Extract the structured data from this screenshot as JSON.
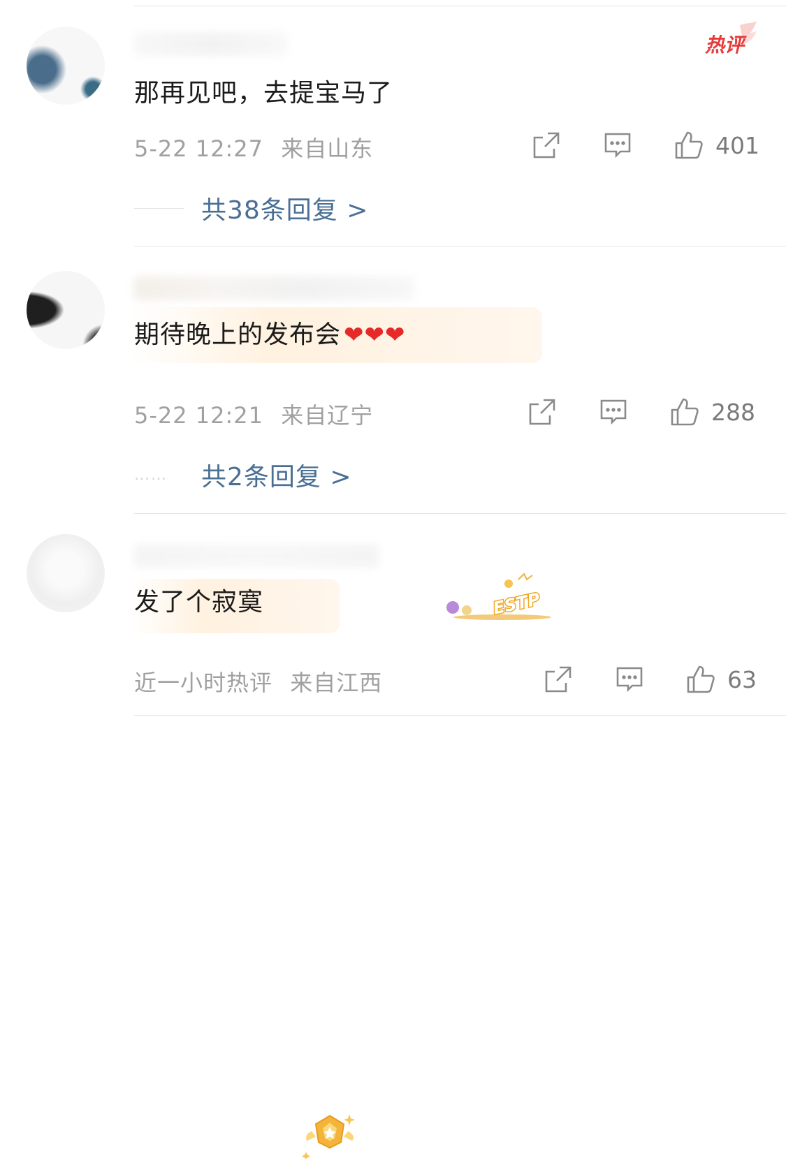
{
  "comments": [
    {
      "text": "那再见吧，去提宝马了",
      "time": "5-22 12:27",
      "location": "来自山东",
      "likes": "401",
      "replies": "共38条回复 >",
      "hot_badge": "热评"
    },
    {
      "text": "期待晚上的发布会",
      "hearts": "❤❤❤",
      "medal_text": "ESTP",
      "time": "5-22 12:21",
      "location": "来自辽宁",
      "likes": "288",
      "reply_prefix": "……",
      "replies": "共2条回复 >"
    },
    {
      "text": "发了个寂寞",
      "time": "近一小时热评",
      "location": "来自江西",
      "likes": "63"
    }
  ],
  "colors": {
    "reply_link": "#4a6f95",
    "meta_text": "#a0a0a0",
    "hot_badge": "#e8393a",
    "heart": "#e62a2a"
  },
  "icons": [
    "share-icon",
    "comment-icon",
    "like-icon"
  ]
}
